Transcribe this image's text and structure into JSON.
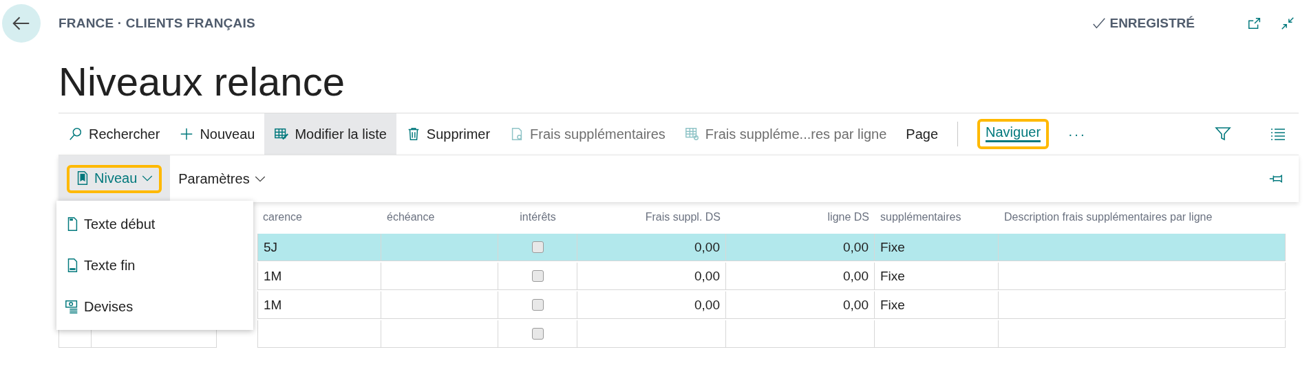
{
  "breadcrumb": "FRANCE · CLIENTS FRANÇAIS",
  "status": "ENREGISTRÉ",
  "title": "Niveaux relance",
  "actions": [
    {
      "kind": "search",
      "label": "Rechercher",
      "selected": false,
      "disabled": false,
      "focused": false
    },
    {
      "kind": "new",
      "label": "Nouveau",
      "selected": false,
      "disabled": false,
      "focused": false
    },
    {
      "kind": "edit-list",
      "label": "Modifier la liste",
      "selected": true,
      "disabled": false,
      "focused": false
    },
    {
      "kind": "delete",
      "label": "Supprimer",
      "selected": false,
      "disabled": false,
      "focused": false
    },
    {
      "kind": "fees",
      "label": "Frais supplémentaires",
      "selected": false,
      "disabled": true,
      "focused": false
    },
    {
      "kind": "line-fees",
      "label": "Frais suppléme...res par ligne",
      "selected": false,
      "disabled": true,
      "focused": false
    },
    {
      "kind": "plain",
      "label": "Page",
      "selected": false,
      "disabled": false,
      "focused": false
    },
    {
      "kind": "separator"
    },
    {
      "kind": "plain",
      "label": "Naviguer",
      "selected": false,
      "disabled": false,
      "focused": true
    },
    {
      "kind": "more",
      "label": "···"
    }
  ],
  "sub_actions": [
    {
      "kind": "level",
      "label": "Niveau",
      "expanded": true,
      "focused": true
    },
    {
      "kind": "plain",
      "label": "Paramètres",
      "expanded": false,
      "focused": false
    }
  ],
  "menu": [
    {
      "kind": "text-start",
      "label": "Texte début"
    },
    {
      "kind": "text-end",
      "label": "Texte fin"
    },
    {
      "kind": "currency",
      "label": "Devises"
    }
  ],
  "table": {
    "columns": [
      "carence",
      "échéance",
      "intérêts",
      "Frais suppl. DS",
      "ligne DS",
      "supplémentaires",
      "Description frais supplémentaires par ligne"
    ],
    "rows": [
      {
        "selected": true,
        "carence": "5J",
        "interets": false,
        "frais_ds": "0,00",
        "ligne_ds": "0,00",
        "type": "Fixe"
      },
      {
        "selected": false,
        "carence": "1M",
        "interets": false,
        "frais_ds": "0,00",
        "ligne_ds": "0,00",
        "type": "Fixe"
      },
      {
        "selected": false,
        "carence": "1M",
        "interets": false,
        "frais_ds": "0,00",
        "ligne_ds": "0,00",
        "type": "Fixe"
      },
      {
        "selected": false,
        "interets": false
      }
    ]
  }
}
